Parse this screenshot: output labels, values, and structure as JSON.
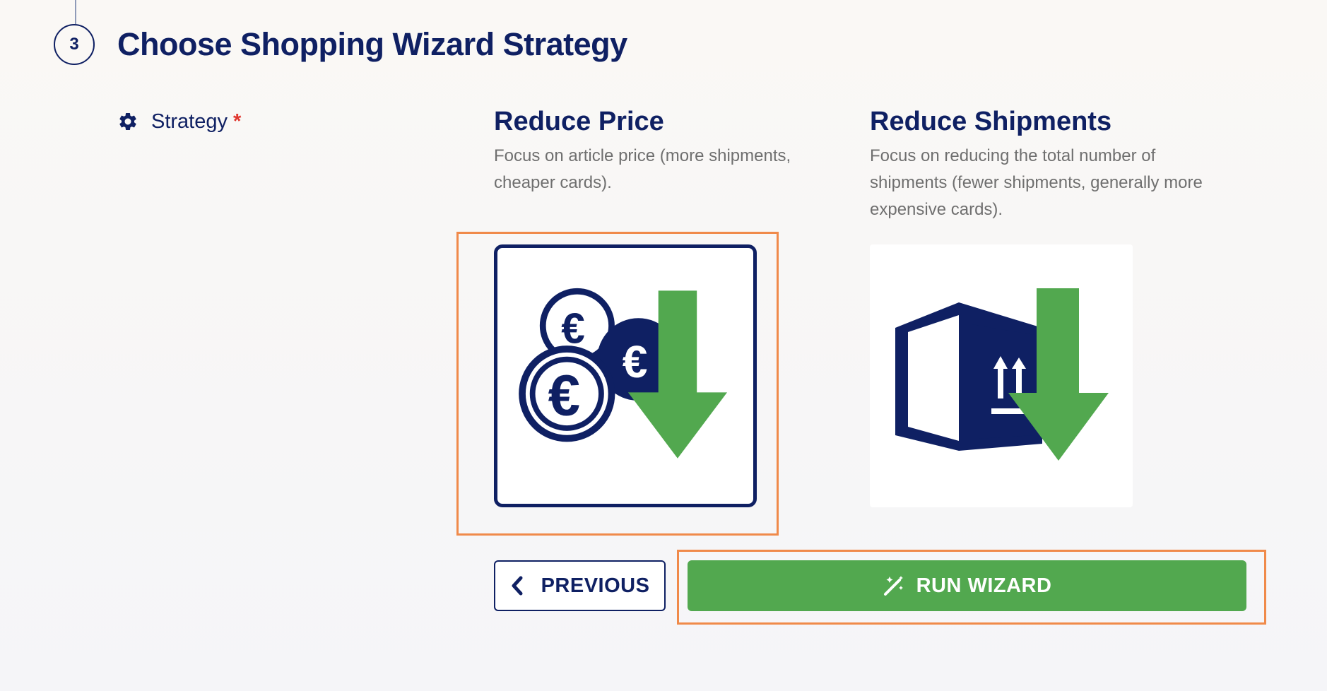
{
  "step": {
    "number": "3",
    "title": "Choose Shopping Wizard Strategy"
  },
  "field": {
    "label": "Strategy",
    "required_marker": "*",
    "icon": "gear-icon"
  },
  "options": [
    {
      "title": "Reduce Price",
      "description": "Focus on article price (more shipments, cheaper cards).",
      "icon": "euro-coins-down-arrow-icon",
      "selected": true
    },
    {
      "title": "Reduce Shipments",
      "description": "Focus on reducing the total number of shipments (fewer shipments, generally more expensive cards).",
      "icon": "package-down-arrow-icon",
      "selected": false
    }
  ],
  "buttons": {
    "previous": "PREVIOUS",
    "run": "RUN WIZARD"
  },
  "colors": {
    "primary": "#0f2063",
    "accent_green": "#52a84f",
    "highlight": "#f08a4a",
    "required": "#e0362e",
    "muted_text": "#6f6f6f"
  }
}
